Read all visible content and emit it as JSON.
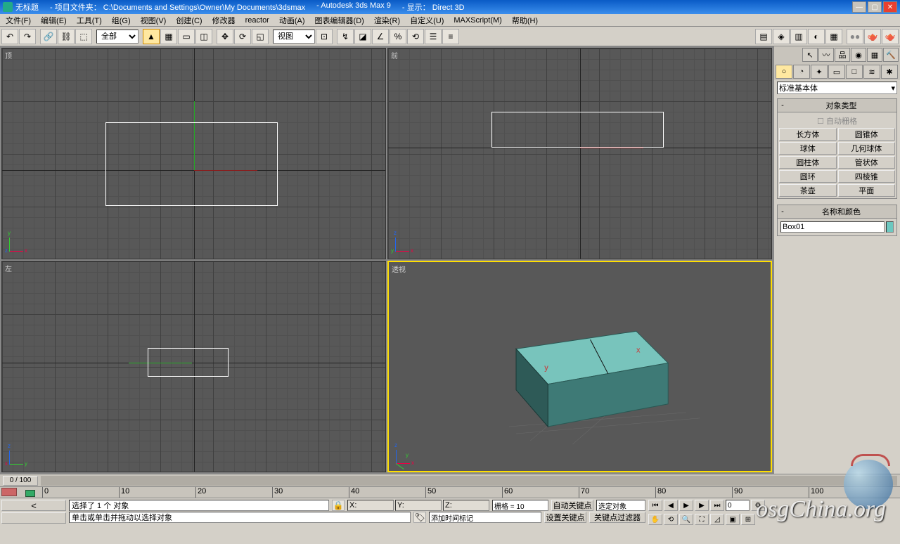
{
  "title": {
    "doc": "无标题",
    "proj_label": "- 项目文件夹：",
    "proj_path": "C:\\Documents and Settings\\Owner\\My Documents\\3dsmax",
    "app": "- Autodesk 3ds Max 9",
    "disp_label": "- 显示：",
    "disp_mode": "Direct 3D"
  },
  "menu": [
    "文件(F)",
    "编辑(E)",
    "工具(T)",
    "组(G)",
    "视图(V)",
    "创建(C)",
    "修改器",
    "reactor",
    "动画(A)",
    "图表编辑器(D)",
    "渲染(R)",
    "自定义(U)",
    "MAXScript(M)",
    "帮助(H)"
  ],
  "toolbar": {
    "sel_filter": "全部",
    "ref_sys": "视图"
  },
  "viewports": {
    "top": "顶",
    "front": "前",
    "left": "左",
    "persp": "透视"
  },
  "sidepanel": {
    "category": "标准基本体",
    "sec_objtype": "对象类型",
    "autogrid": "自动栅格",
    "buttons": [
      [
        "长方体",
        "圆锥体"
      ],
      [
        "球体",
        "几何球体"
      ],
      [
        "圆柱体",
        "管状体"
      ],
      [
        "圆环",
        "四棱锥"
      ],
      [
        "茶壶",
        "平面"
      ]
    ],
    "sec_name": "名称和颜色",
    "obj_name": "Box01"
  },
  "timeline": {
    "pos": "0 / 100",
    "ticks": [
      0,
      10,
      20,
      30,
      40,
      50,
      60,
      70,
      80,
      90,
      100
    ]
  },
  "status": {
    "sel": "选择了 1 个 对象",
    "hint": "单击或单击并拖动以选择对象",
    "x": "X:",
    "y": "Y:",
    "z": "Z:",
    "grid_lbl": "栅格 = 10",
    "autokey": "自动关键点",
    "selset": "选定对象",
    "setkey": "设置关键点",
    "keyfilter": "关键点过滤器",
    "addmark": "添加时间标记"
  },
  "watermark": "osgChina.org"
}
